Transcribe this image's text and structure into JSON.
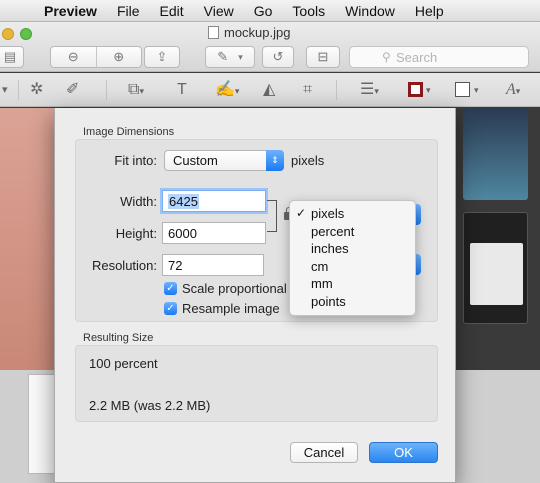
{
  "menubar": {
    "app_name": "Preview",
    "items": [
      "File",
      "Edit",
      "View",
      "Go",
      "Tools",
      "Window",
      "Help"
    ]
  },
  "window": {
    "title": "mockup.jpg",
    "search_placeholder": "Search"
  },
  "dialog": {
    "image_dimensions_label": "Image Dimensions",
    "fit_into_label": "Fit into:",
    "fit_into_value": "Custom",
    "fit_into_units": "pixels",
    "width_label": "Width:",
    "width_value": "6425",
    "height_label": "Height:",
    "height_value": "6000",
    "resolution_label": "Resolution:",
    "resolution_value": "72",
    "scale_proportionally_label": "Scale proportional",
    "scale_proportionally_checked": true,
    "resample_label": "Resample image",
    "resample_checked": true,
    "resulting_size_label": "Resulting Size",
    "result_percent": "100 percent",
    "result_size": "2.2 MB (was 2.2 MB)",
    "cancel_label": "Cancel",
    "ok_label": "OK"
  },
  "units_menu": {
    "selected": "pixels",
    "options": [
      "pixels",
      "percent",
      "inches",
      "cm",
      "mm",
      "points"
    ]
  },
  "colors": {
    "accent": "#1b79f2",
    "selection": "#b3d4fd",
    "border_color_swatch": "#8b1a1a"
  },
  "icons": {
    "apple": "",
    "check": "✓"
  }
}
